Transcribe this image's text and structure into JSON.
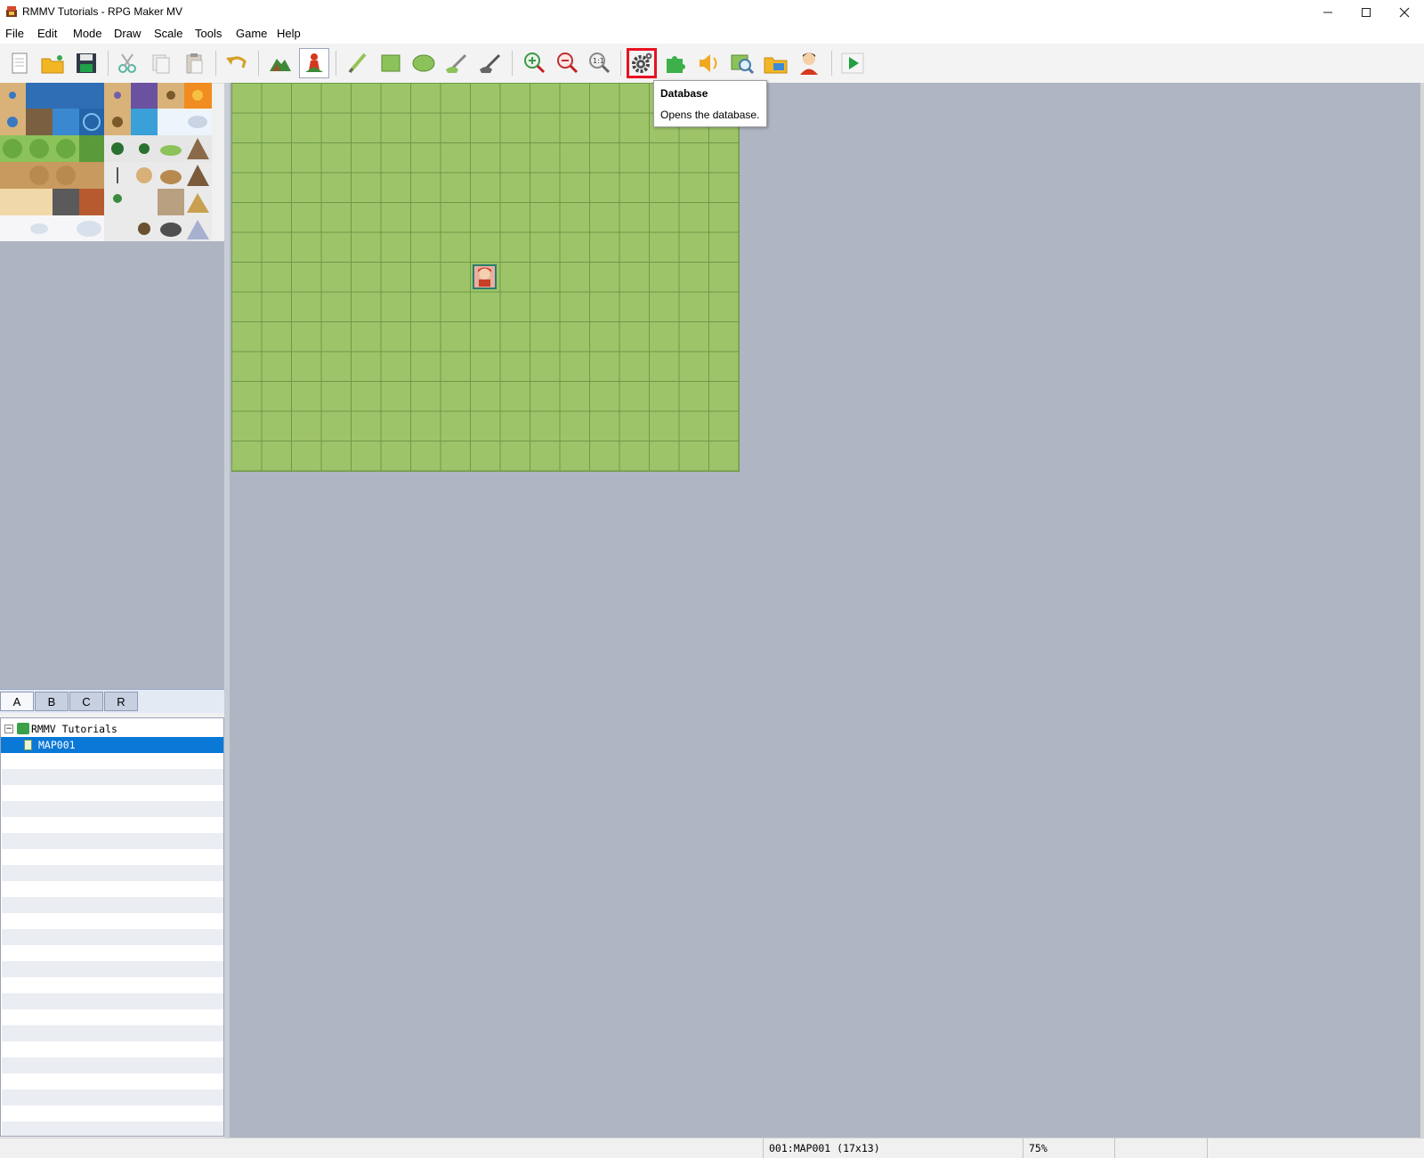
{
  "window": {
    "title": "RMMV Tutorials - RPG Maker MV",
    "minimize_icon": "minimize-icon",
    "maximize_icon": "maximize-icon",
    "close_icon": "close-icon"
  },
  "menu": [
    "File",
    "Edit",
    "Mode",
    "Draw",
    "Scale",
    "Tools",
    "Game",
    "Help"
  ],
  "toolbar": {
    "buttons": [
      "new-project",
      "open-project",
      "save-project",
      "cut",
      "copy",
      "paste",
      "undo",
      "map-mode",
      "event-mode",
      "pencil",
      "rectangle",
      "ellipse",
      "flood-fill",
      "shadow-pen",
      "zoom-in",
      "zoom-out",
      "actual-size",
      "database",
      "plugin-manager",
      "sound-test",
      "event-searcher",
      "resource-manager",
      "character-generator",
      "playtest"
    ],
    "highlighted": "database",
    "highlight_color": "#e81123",
    "active": "event-mode"
  },
  "tooltip": {
    "title": "Database",
    "text": "Opens the database."
  },
  "tileset": {
    "tab_labels": [
      "A",
      "B",
      "C",
      "R"
    ],
    "active_tab": "A"
  },
  "map_tree": {
    "project": "RMMV Tutorials",
    "maps": [
      {
        "name": "MAP001",
        "selected": true
      }
    ],
    "selection_color": "#0a78d7"
  },
  "map": {
    "columns": 17,
    "rows": 13,
    "grass_color": "#9ec46a"
  },
  "status": {
    "map_info": "001:MAP001 (17x13)",
    "zoom": "75%"
  }
}
